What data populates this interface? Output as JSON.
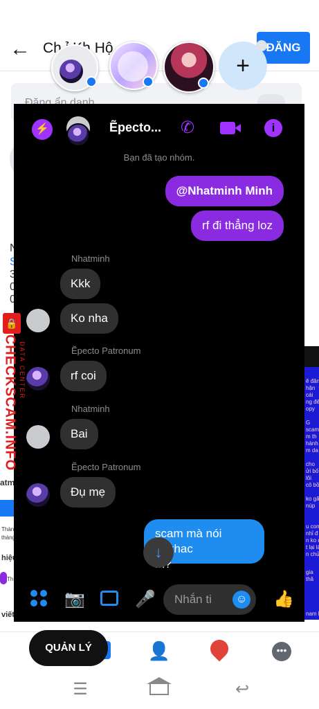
{
  "background": {
    "title": "Chỉnh sửa Khoảnh khắc Hội",
    "title_visible": "Ch  ỉ  Kh   Hộ",
    "post_button": "ĐĂNG",
    "hidden_label": "Đăng ẩn danh",
    "left_fragments": [
      "N",
      "S",
      "3",
      "0",
      "0",
      "atm",
      "Thàn",
      "tháng",
      "hiệu",
      "Th",
      "viết"
    ],
    "right_fragments": [
      "ẽ đăng",
      "hận",
      "cái",
      "ng đế",
      "opy",
      "G",
      "scam",
      "m th",
      "hành",
      "m da",
      "cho",
      "ửi bố",
      "lôi",
      "cô bồ",
      "ko gã",
      "núp",
      "u con",
      "nhỉ đ",
      "n ko đ",
      "t lại là",
      "n chửi",
      "gia",
      "thă",
      "nam lo"
    ]
  },
  "chat": {
    "name": "Ẽpecto...",
    "system_message": "Bạn đã tạo nhóm.",
    "messages": [
      {
        "type": "out",
        "text": "@Nhatminh Minh"
      },
      {
        "type": "out",
        "text": "rf đi thẳng loz"
      },
      {
        "type": "sender",
        "text": "Nhatminh"
      },
      {
        "type": "in",
        "text": "Kkk"
      },
      {
        "type": "in",
        "text": "Ko nha"
      },
      {
        "type": "sender",
        "text": "Ẽpecto Patronum"
      },
      {
        "type": "in",
        "text": "rf coi"
      },
      {
        "type": "sender",
        "text": "Nhatminh"
      },
      {
        "type": "in",
        "text": "Bai"
      },
      {
        "type": "sender",
        "text": "Ẽpecto Patronum"
      },
      {
        "type": "in",
        "text": "Đụ mẹ"
      },
      {
        "type": "out_blue",
        "text": "scam mà nói ngkhac\nm?"
      }
    ],
    "composer_placeholder": "Nhắn ti"
  },
  "icons": {
    "back": "back-arrow-icon",
    "messenger": "messenger-icon",
    "call": "phone-icon",
    "video": "video-icon",
    "info": "info-icon"
  },
  "watermark": {
    "text": "CHECKSCAM.INFO",
    "sub": "DATA CENTER"
  },
  "bottom_nav": {
    "manage_label": "QUẢN LÝ"
  },
  "colors": {
    "messenger_purple": "#8a2be2",
    "facebook_blue": "#1877f2",
    "chat_bg": "#000000",
    "watermark_red": "#e11d1d"
  }
}
